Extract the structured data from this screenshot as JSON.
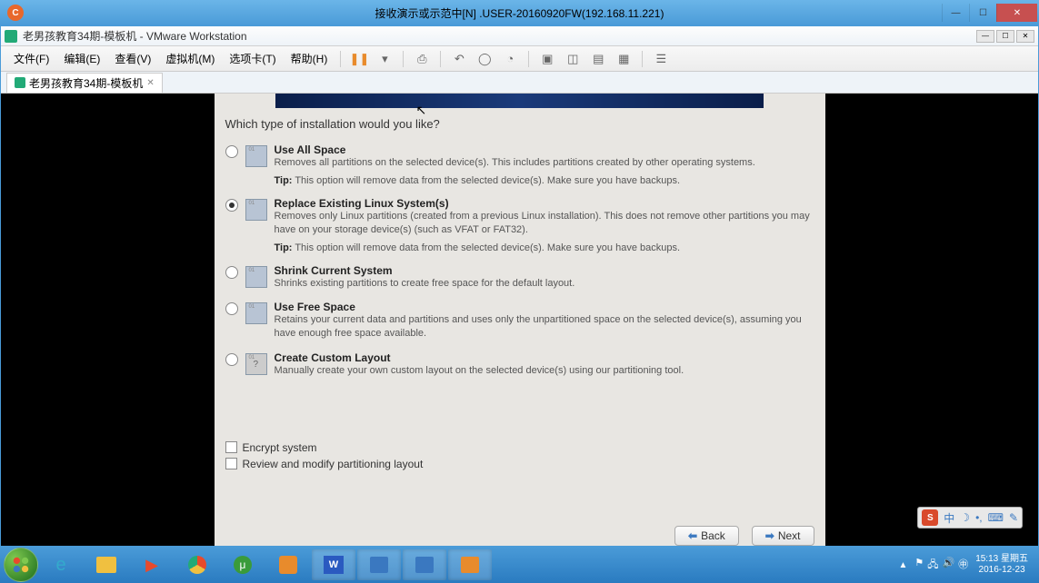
{
  "outer_window": {
    "title": "接收演示或示范中[N] .USER-20160920FW(192.168.11.221)"
  },
  "vmware": {
    "title": "老男孩教育34期-模板机 - VMware Workstation",
    "menu": [
      "文件(F)",
      "编辑(E)",
      "查看(V)",
      "虚拟机(M)",
      "选项卡(T)",
      "帮助(H)"
    ],
    "tab": "老男孩教育34期-模板机"
  },
  "installer": {
    "question": "Which type of installation would you like?",
    "options": [
      {
        "id": "use-all-space",
        "title": "Use All Space",
        "desc": "Removes all partitions on the selected device(s).  This includes partitions created by other operating systems.",
        "tip_label": "Tip:",
        "tip": " This option will remove data from the selected device(s).  Make sure you have backups.",
        "checked": false
      },
      {
        "id": "replace-existing",
        "title": "Replace Existing Linux System(s)",
        "desc": "Removes only Linux partitions (created from a previous Linux installation).  This does not remove other partitions you may have on your storage device(s) (such as VFAT or FAT32).",
        "tip_label": "Tip:",
        "tip": " This option will remove data from the selected device(s).  Make sure you have backups.",
        "checked": true
      },
      {
        "id": "shrink-current",
        "title": "Shrink Current System",
        "desc": "Shrinks existing partitions to create free space for the default layout.",
        "checked": false
      },
      {
        "id": "use-free-space",
        "title": "Use Free Space",
        "desc": "Retains your current data and partitions and uses only the unpartitioned space on the selected device(s), assuming you have enough free space available.",
        "checked": false
      },
      {
        "id": "custom-layout",
        "title": "Create Custom Layout",
        "desc": "Manually create your own custom layout on the selected device(s) using our partitioning tool.",
        "checked": false
      }
    ],
    "encrypt_label": "Encrypt system",
    "review_label": "Review and modify partitioning layout",
    "back_label": "Back",
    "next_label": "Next"
  },
  "ime": {
    "lang": "中"
  },
  "tray": {
    "time": "15:13",
    "weekday": "星期五",
    "date": "2016-12-23"
  }
}
